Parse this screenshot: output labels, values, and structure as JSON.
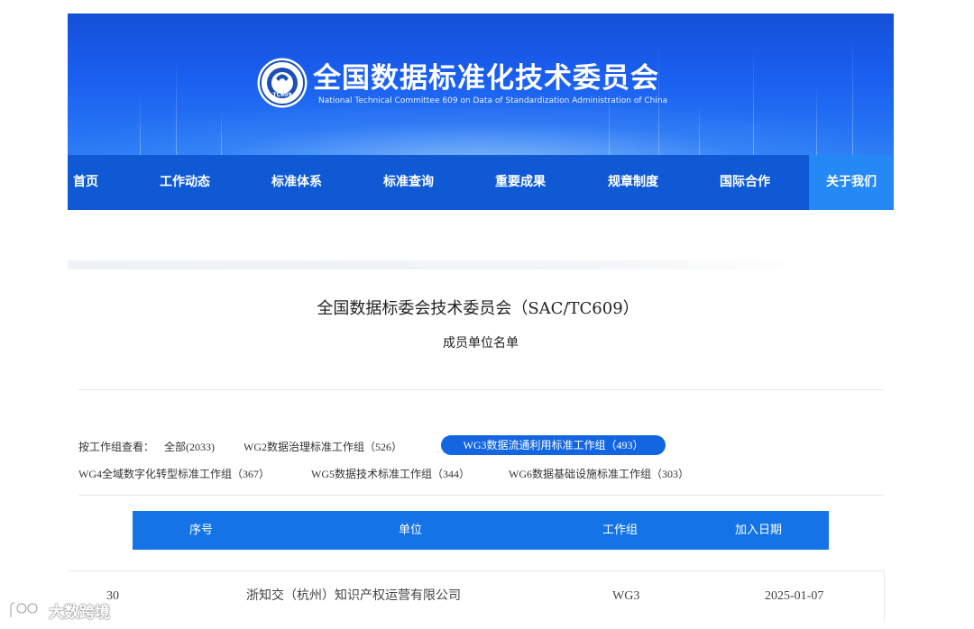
{
  "header": {
    "title": "全国数据标准化技术委员会",
    "subtitle": "National Technical Committee 609 on Data of Standardization Administration of China",
    "logo_text": "TC609"
  },
  "nav": {
    "items": [
      "首页",
      "工作动态",
      "标准体系",
      "标准查询",
      "重要成果",
      "规章制度",
      "国际合作",
      "关于我们"
    ],
    "active": "关于我们"
  },
  "page": {
    "title": "全国数据标委会技术委员会（SAC/TC609）",
    "subtitle": "成员单位名单"
  },
  "filter": {
    "label": "按工作组查看：",
    "options": [
      "全部(2033)",
      "WG2数据治理标准工作组（526）",
      "WG3数据流通利用标准工作组（493）",
      "WG4全域数字化转型标准工作组（367）",
      "WG5数据技术标准工作组（344）",
      "WG6数据基础设施标准工作组（303）"
    ],
    "selected": "WG3数据流通利用标准工作组（493）"
  },
  "table": {
    "headers": [
      "序号",
      "单位",
      "工作组",
      "加入日期"
    ],
    "rows": [
      [
        "30",
        "浙知交（杭州）知识产权运营有限公司",
        "WG3",
        "2025-01-07"
      ]
    ]
  },
  "watermark": {
    "text": "大数跨境"
  },
  "colors": {
    "nav_bg": "#0f5ad4",
    "nav_active": "#2488f5",
    "table_header": "#1473e6",
    "pill": "#1366e0"
  }
}
